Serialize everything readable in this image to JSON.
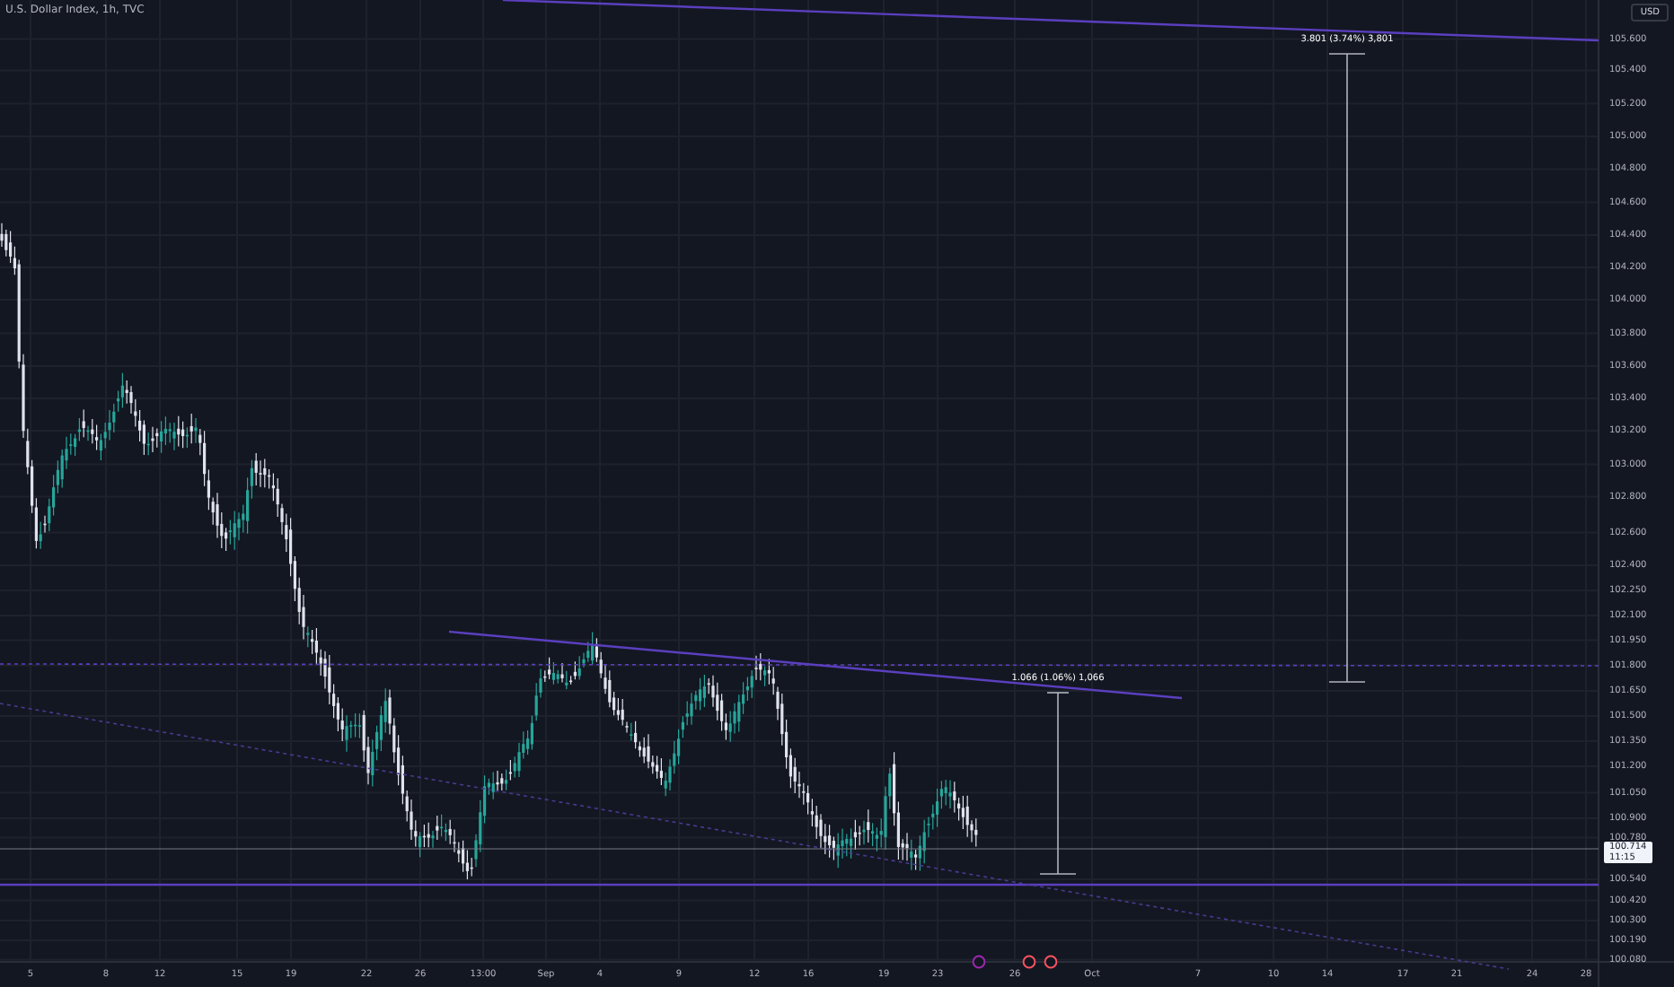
{
  "title": "U.S. Dollar Index, 1h, TVC",
  "currency": "USD",
  "price_axis": [
    "105.600",
    "105.400",
    "105.200",
    "105.000",
    "104.800",
    "104.600",
    "104.400",
    "104.200",
    "104.000",
    "103.800",
    "103.600",
    "103.400",
    "103.200",
    "103.000",
    "102.800",
    "102.600",
    "102.400",
    "102.250",
    "102.100",
    "101.950",
    "101.800",
    "101.650",
    "101.500",
    "101.350",
    "101.200",
    "101.050",
    "100.900",
    "100.780",
    "100.540",
    "100.420",
    "100.300",
    "100.190",
    "100.080"
  ],
  "last_price": {
    "price": "100.714",
    "countdown": "11:15"
  },
  "time_axis": [
    "5",
    "8",
    "12",
    "15",
    "19",
    "22",
    "26",
    "13:00",
    "Sep",
    "4",
    "9",
    "12",
    "16",
    "19",
    "23",
    "26",
    "Oct",
    "7",
    "10",
    "14",
    "17",
    "21",
    "24",
    "28"
  ],
  "measurements": [
    "3.801 (3.74%) 3,801",
    "1.066 (1.06%) 1,066"
  ],
  "event_markers": [
    {
      "kind": "dividend"
    },
    {
      "kind": "earnings"
    },
    {
      "kind": "earnings"
    }
  ]
}
